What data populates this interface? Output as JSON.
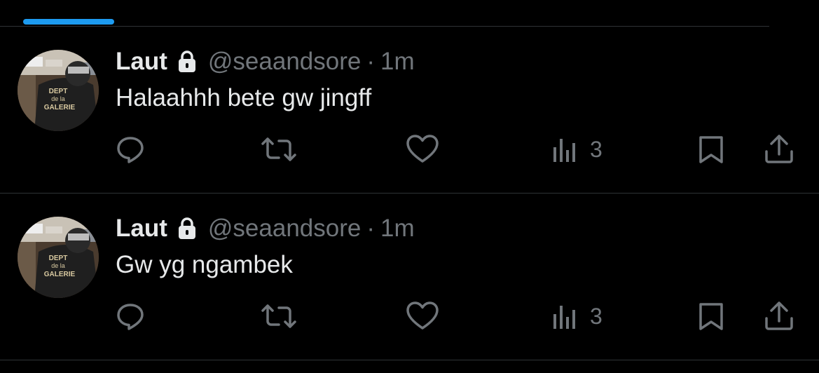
{
  "colors": {
    "background": "#000000",
    "accent": "#1d9bf0",
    "text_primary": "#e7e9ea",
    "text_secondary": "#71767b",
    "divider": "#2f3336"
  },
  "tweets": [
    {
      "author": {
        "display_name": "Laut",
        "handle": "@seaandsore",
        "protected_icon": "lock-icon"
      },
      "separator": "·",
      "time": "1m",
      "text": "Halaahhh bete gw jingff",
      "avatar_text": [
        "DEPT",
        "de la",
        "GALERIE"
      ],
      "actions": {
        "reply_icon": "reply-icon",
        "retweet_icon": "retweet-icon",
        "like_icon": "like-icon",
        "views_icon": "views-icon",
        "views_count": "3",
        "bookmark_icon": "bookmark-icon",
        "share_icon": "share-icon"
      }
    },
    {
      "author": {
        "display_name": "Laut",
        "handle": "@seaandsore",
        "protected_icon": "lock-icon"
      },
      "separator": "·",
      "time": "1m",
      "text": "Gw yg ngambek",
      "avatar_text": [
        "DEPT",
        "de la",
        "GALERIE"
      ],
      "actions": {
        "reply_icon": "reply-icon",
        "retweet_icon": "retweet-icon",
        "like_icon": "like-icon",
        "views_icon": "views-icon",
        "views_count": "3",
        "bookmark_icon": "bookmark-icon",
        "share_icon": "share-icon"
      }
    }
  ]
}
